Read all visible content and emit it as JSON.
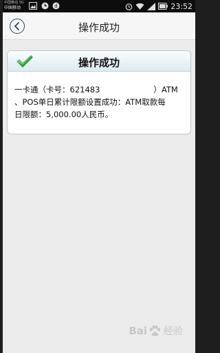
{
  "status_bar": {
    "carrier_top": "中国移动 3G",
    "carrier": "中国移动",
    "time": "23:52",
    "icons": [
      "image-icon",
      "clock-icon",
      "notification-icon",
      "alarm-icon",
      "wifi-icon",
      "signal-icon",
      "battery-icon"
    ]
  },
  "header": {
    "title": "操作成功",
    "back_icon": "back-arrow-icon",
    "accent": "#2c3e63"
  },
  "card": {
    "title": "操作成功",
    "check_color": "#2e9e3c",
    "line1_before": "一卡通（卡号：621483",
    "line1_after": "）ATM",
    "line2": "、POS单日累计限额设置成功：ATM取款每",
    "line3": "日限额：5,000.00人民币。"
  },
  "watermark": {
    "brand_left": "Bai",
    "brand_right": "经验"
  }
}
